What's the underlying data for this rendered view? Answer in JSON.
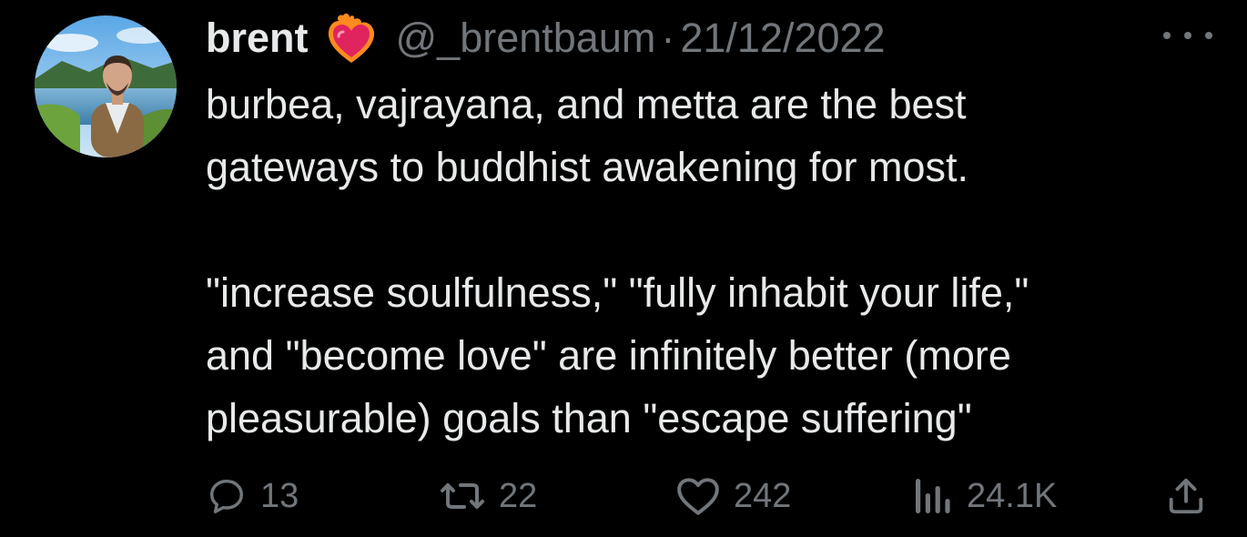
{
  "tweet": {
    "display_name": "brent",
    "badge_icon": "heart-on-fire-icon",
    "handle": "@_brentbaum",
    "separator": "·",
    "date": "21/12/2022",
    "body_lines": [
      "burbea, vajrayana, and metta are the best",
      "gateways to buddhist awakening for most.",
      "",
      "\"increase soulfulness,\" \"fully inhabit your life,\"",
      "and \"become love\" are infinitely better (more",
      "pleasurable) goals than \"escape suffering\""
    ]
  },
  "actions": {
    "reply": {
      "icon": "reply-icon",
      "count": "13"
    },
    "retweet": {
      "icon": "retweet-icon",
      "count": "22"
    },
    "like": {
      "icon": "heart-icon",
      "count": "242"
    },
    "views": {
      "icon": "analytics-icon",
      "count": "24.1K"
    },
    "share": {
      "icon": "share-icon"
    }
  },
  "colors": {
    "background": "#000000",
    "primary_text": "#e7e9ea",
    "secondary_text": "#71767b"
  }
}
